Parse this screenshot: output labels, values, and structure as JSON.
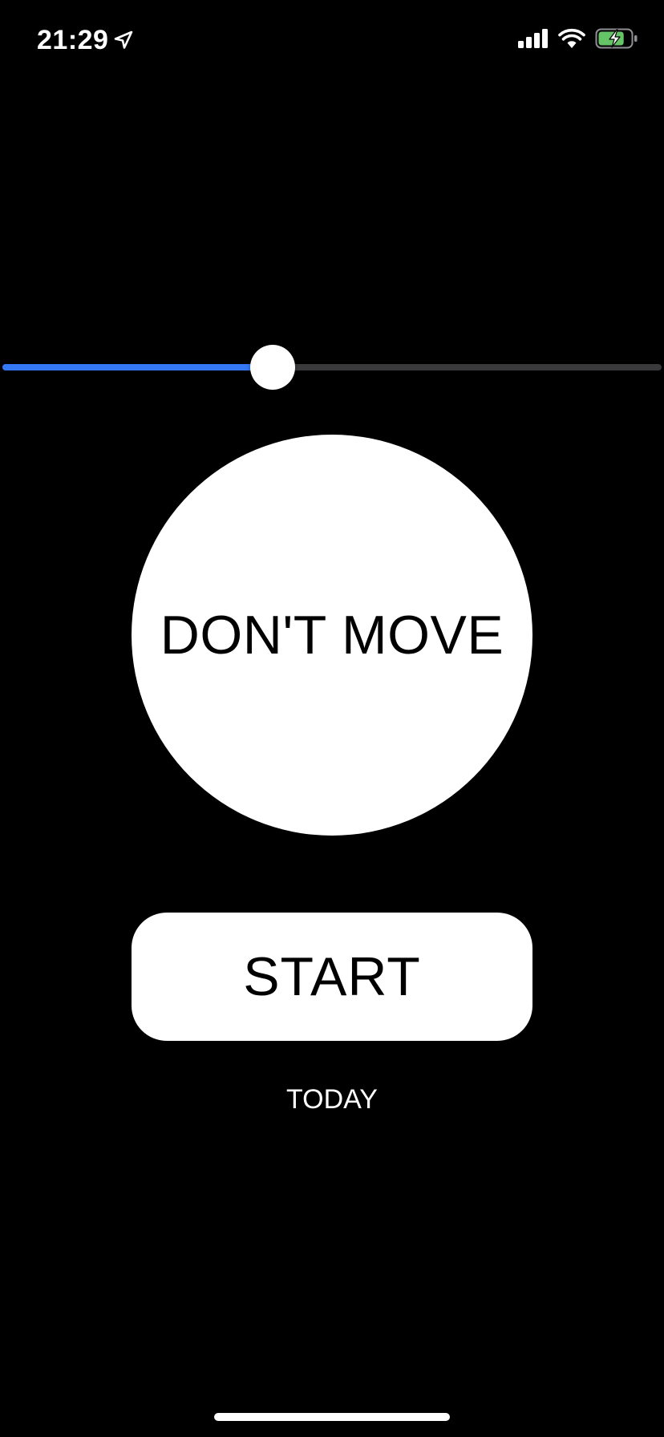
{
  "status_bar": {
    "time": "21:29",
    "location_icon": "location-arrow-icon",
    "signal_icon": "cellular-signal-icon",
    "wifi_icon": "wifi-icon",
    "battery_icon": "battery-charging-icon",
    "battery_level": 0.8
  },
  "slider": {
    "value": 0.41,
    "fill_color": "#3478f6",
    "track_color": "#3a3a3c"
  },
  "main": {
    "circle_label": "DON'T MOVE",
    "circle_color": "#ffffff",
    "start_label": "START",
    "start_color": "#ffffff",
    "today_label": "TODAY"
  },
  "colors": {
    "background": "#000000",
    "text": "#ffffff",
    "battery_green": "#65c466"
  }
}
